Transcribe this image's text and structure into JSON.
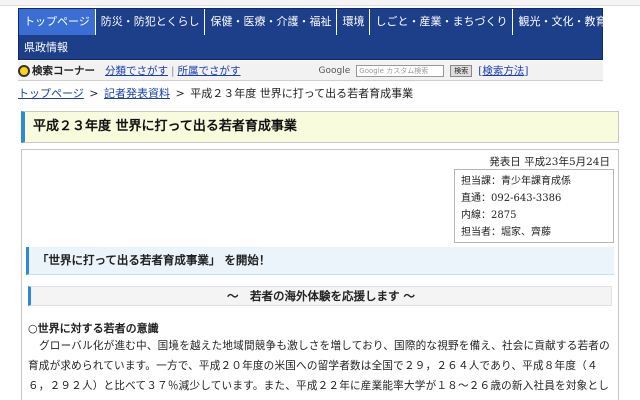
{
  "nav": {
    "row1": [
      "トップページ",
      "防災・防犯とくらし",
      "保健・医療・介護・福祉",
      "環境",
      "しごと・産業・まちづくり",
      "観光・文化・教育"
    ],
    "row2": [
      "県政情報"
    ],
    "active_index": 0,
    "bg_color": "#1d3f8a",
    "active_color": "#3b6ed3"
  },
  "search": {
    "corner_label": "検索コーナー",
    "by_category": "分類でさがす",
    "by_department": "所属でさがす",
    "google_label": "Google",
    "google_placeholder": "Google カスタム検索",
    "google_button": "検索",
    "help_open": "[",
    "help_label": "検索方法",
    "help_close": "]"
  },
  "breadcrumb": {
    "top": "トップページ",
    "press": "記者発表資料",
    "current": "平成２３年度 世界に打って出る若者育成事業",
    "arrow": ">"
  },
  "page": {
    "title": "平成２３年度 世界に打って出る若者育成事業",
    "publish_date": "発表日 平成23年5月24日"
  },
  "contact": {
    "lines": [
      "担当課：青少年課育成係",
      "直通：092-643-3386",
      "内線：2875",
      "担当者：堀家、齊藤"
    ]
  },
  "content": {
    "heading2": "「世界に打って出る若者育成事業」 を開始！",
    "heading3": "～　若者の海外体験を応援します ～",
    "section_title": "○世界に対する若者の意識",
    "paragraph": "グローバル化が進む中、国境を越えた地域間競争も激しさを増しており、国際的な視野を備え、社会に貢献する若者の育成が求められています。一方で、平成２０年度の米国への留学者数は全国で２９，２６４人であり、平成８年度（４６，２９２人）と比べて３７％減少しています。また、平成２２年に産業能率大学が１８～２６歳の新入社員を対象とし"
  },
  "colors": {
    "accent_blue": "#2d8ad6",
    "title_bg": "#f8fbdc",
    "link": "#1a3fb0"
  }
}
